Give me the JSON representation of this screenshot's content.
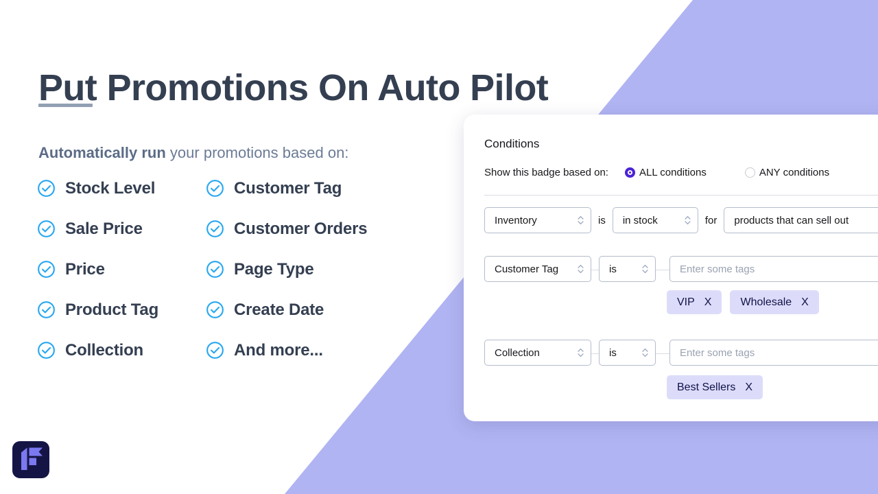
{
  "hero": {
    "title": "Put Promotions On Auto Pilot",
    "subtitle_strong": "Automatically run",
    "subtitle_rest": " your promotions based on:",
    "features_left": [
      {
        "label": "Stock Level",
        "icon": "check-circle-icon"
      },
      {
        "label": "Sale Price",
        "icon": "check-circle-icon"
      },
      {
        "label": "Price",
        "icon": "check-circle-icon"
      },
      {
        "label": "Product Tag",
        "icon": "check-circle-icon"
      },
      {
        "label": "Collection",
        "icon": "check-circle-icon"
      }
    ],
    "features_right": [
      {
        "label": "Customer Tag",
        "icon": "check-circle-icon"
      },
      {
        "label": "Customer Orders",
        "icon": "check-circle-icon"
      },
      {
        "label": "Page Type",
        "icon": "check-circle-icon"
      },
      {
        "label": "Create Date",
        "icon": "check-circle-icon"
      },
      {
        "label": "And more...",
        "icon": "check-circle-icon"
      }
    ]
  },
  "logo": {
    "name": "app-logo-icon"
  },
  "card": {
    "title": "Conditions",
    "basis_label": "Show this badge based on:",
    "radio_all_label": "ALL conditions",
    "radio_any_label": "ANY conditions",
    "radio_selected": "ALL conditions",
    "rows": [
      {
        "subject": "Inventory",
        "operator": "is",
        "value": "in stock",
        "connector": "for",
        "scope": "products that can sell out",
        "tags": []
      },
      {
        "subject": "Customer Tag",
        "operator": "is",
        "tags_placeholder": "Enter some tags",
        "tags": [
          "VIP",
          "Wholesale"
        ],
        "tag_remove_label": "X"
      },
      {
        "subject": "Collection",
        "operator": "is",
        "tags_placeholder": "Enter some tags",
        "tags": [
          "Best Sellers"
        ],
        "tag_remove_label": "X"
      }
    ]
  },
  "colors": {
    "background": "#ffffff",
    "accent_purple": "#b0b4f2",
    "title_slate": "#343f51",
    "subtitle_slate": "#6b7b95",
    "check_blue": "#29a8f0",
    "radio_selected": "#4b23d6",
    "tag_background": "#dcdcfa",
    "tag_text": "#11114a",
    "logo_background": "#151545",
    "logo_mark": "#7b79f0",
    "field_border": "#b4bccb",
    "divider": "#d9dce3"
  }
}
